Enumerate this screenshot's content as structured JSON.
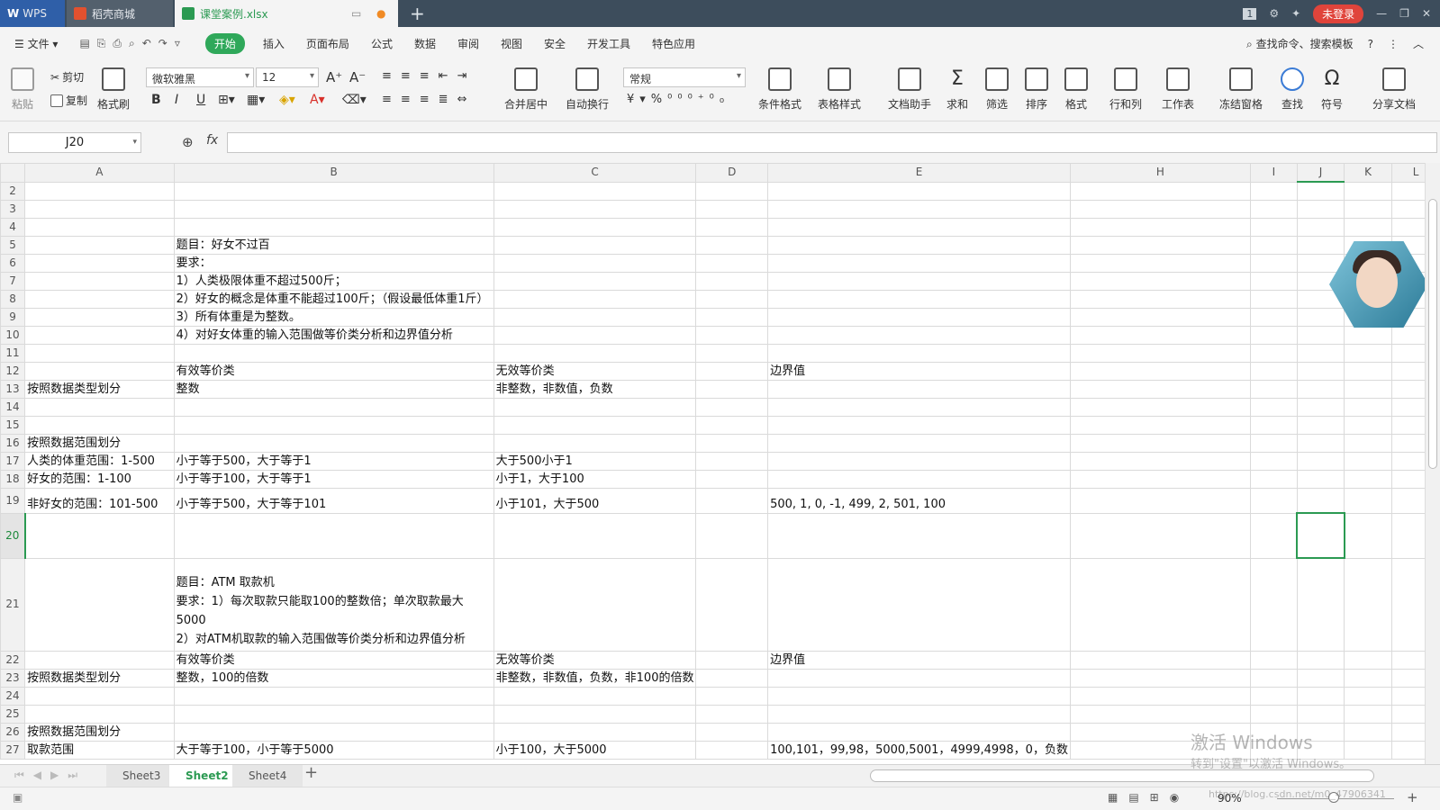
{
  "titlebar": {
    "tabs": [
      {
        "label": "WPS"
      },
      {
        "label": "稻壳商城"
      },
      {
        "label": "课堂案例.xlsx"
      }
    ],
    "login_label": "未登录",
    "badge": "1"
  },
  "menu": {
    "file_label": "文件",
    "items": [
      "开始",
      "插入",
      "页面布局",
      "公式",
      "数据",
      "审阅",
      "视图",
      "安全",
      "开发工具",
      "特色应用"
    ],
    "search_label": "查找命令、搜索模板",
    "help": "?"
  },
  "ribbon": {
    "paste": "粘贴",
    "cut": "剪切",
    "copy": "复制",
    "format_painter": "格式刷",
    "font_name": "微软雅黑",
    "font_size": "12",
    "number_format": "常规",
    "merge_center": "合并居中",
    "wrap_text": "自动换行",
    "cond_format": "条件格式",
    "table_style": "表格样式",
    "doc_helper": "文档助手",
    "sum": "求和",
    "filter": "筛选",
    "sort": "排序",
    "format": "格式",
    "row_col": "行和列",
    "worksheet": "工作表",
    "freeze": "冻结窗格",
    "find": "查找",
    "symbol": "符号",
    "share": "分享文档",
    "bold": "B",
    "italic": "I",
    "underline": "U"
  },
  "formula_bar": {
    "name_box": "J20",
    "fx": "fx",
    "value": ""
  },
  "columns": [
    "A",
    "B",
    "C",
    "D",
    "E",
    "H",
    "I",
    "J",
    "K",
    "L"
  ],
  "rows": [
    {
      "n": "2",
      "h": 19,
      "A": "",
      "B": "",
      "C": "",
      "E": ""
    },
    {
      "n": "3",
      "h": 19,
      "A": "",
      "B": "",
      "C": "",
      "E": ""
    },
    {
      "n": "4",
      "h": 19,
      "A": "",
      "B": "",
      "C": "",
      "E": ""
    },
    {
      "n": "5",
      "h": 19,
      "A": "",
      "B": "题目：好女不过百",
      "C": "",
      "E": ""
    },
    {
      "n": "6",
      "h": 19,
      "A": "",
      "B": "要求：",
      "C": "",
      "E": ""
    },
    {
      "n": "7",
      "h": 19,
      "A": "",
      "B": "1）人类极限体重不超过500斤；",
      "C": "",
      "E": ""
    },
    {
      "n": "8",
      "h": 19,
      "A": "",
      "B": "2）好女的概念是体重不能超过100斤；（假设最低体重1斤）",
      "C": "",
      "E": ""
    },
    {
      "n": "9",
      "h": 19,
      "A": "",
      "B": "3）所有体重是为整数。",
      "C": "",
      "E": ""
    },
    {
      "n": "10",
      "h": 19,
      "A": "",
      "B": "4）对好女体重的输入范围做等价类分析和边界值分析",
      "C": "",
      "E": ""
    },
    {
      "n": "11",
      "h": 19,
      "A": "",
      "B": "",
      "C": "",
      "E": ""
    },
    {
      "n": "12",
      "h": 19,
      "A": "",
      "B": "有效等价类",
      "C": "无效等价类",
      "E": "边界值"
    },
    {
      "n": "13",
      "h": 19,
      "A": "按照数据类型划分",
      "B": "整数",
      "C": "非整数，非数值，负数",
      "E": ""
    },
    {
      "n": "14",
      "h": 19,
      "A": "",
      "B": "",
      "C": "",
      "E": ""
    },
    {
      "n": "15",
      "h": 19,
      "A": "",
      "B": "",
      "C": "",
      "E": ""
    },
    {
      "n": "16",
      "h": 19,
      "A": "按照数据范围划分",
      "B": "",
      "C": "",
      "E": ""
    },
    {
      "n": "17",
      "h": 19,
      "A": "人类的体重范围：1-500",
      "B": "小于等于500，大于等于1",
      "C": "大于500小于1",
      "E": ""
    },
    {
      "n": "18",
      "h": 19,
      "A": "好女的范围：1-100",
      "B": "小于等于100，大于等于1",
      "C": "小于1，大于100",
      "E": ""
    },
    {
      "n": "19",
      "h": 28,
      "A": "非好女的范围：101-500",
      "B": "小于等于500，大于等于101",
      "C": "小于101，大于500",
      "E": "500, 1, 0, -1, 499, 2, 501,  100"
    },
    {
      "n": "20",
      "h": 50,
      "A": "",
      "B": "",
      "C": "",
      "E": ""
    },
    {
      "n": "21",
      "h": 103,
      "A": "",
      "B": "题目：ATM 取款机\n要求：1）每次取款只能取100的整数倍；单次取款最大\n5000\n2）对ATM机取款的输入范围做等价类分析和边界值分析",
      "C": "",
      "E": ""
    },
    {
      "n": "22",
      "h": 19,
      "A": "",
      "B": "有效等价类",
      "C": "无效等价类",
      "E": "边界值"
    },
    {
      "n": "23",
      "h": 19,
      "A": "按照数据类型划分",
      "B": "整数，100的倍数",
      "C": "非整数，非数值，负数，非100的倍数",
      "E": ""
    },
    {
      "n": "24",
      "h": 19,
      "A": "",
      "B": "",
      "C": "",
      "E": ""
    },
    {
      "n": "25",
      "h": 19,
      "A": "",
      "B": "",
      "C": "",
      "E": ""
    },
    {
      "n": "26",
      "h": 19,
      "A": "按照数据范围划分",
      "B": "",
      "C": "",
      "E": ""
    },
    {
      "n": "27",
      "h": 19,
      "A": "取款范围",
      "B": "大于等于100，小于等于5000",
      "C": "小于100，大于5000",
      "E": "100,101，99,98，5000,5001，4999,4998，0，负数"
    }
  ],
  "sheet_tabs": [
    "Sheet3",
    "Sheet2",
    "Sheet4"
  ],
  "active_sheet": "Sheet2",
  "status": {
    "zoom": "90%",
    "url": "https://blog.csdn.net/m0_47906341"
  },
  "watermark": {
    "line1": "激活 Windows",
    "line2": "转到\"设置\"以激活 Windows。"
  },
  "colors": {
    "accent": "#2b9a52",
    "titlebar": "#3d4d5c",
    "wps_tab": "#2f5fa8",
    "login": "#e0443b"
  }
}
